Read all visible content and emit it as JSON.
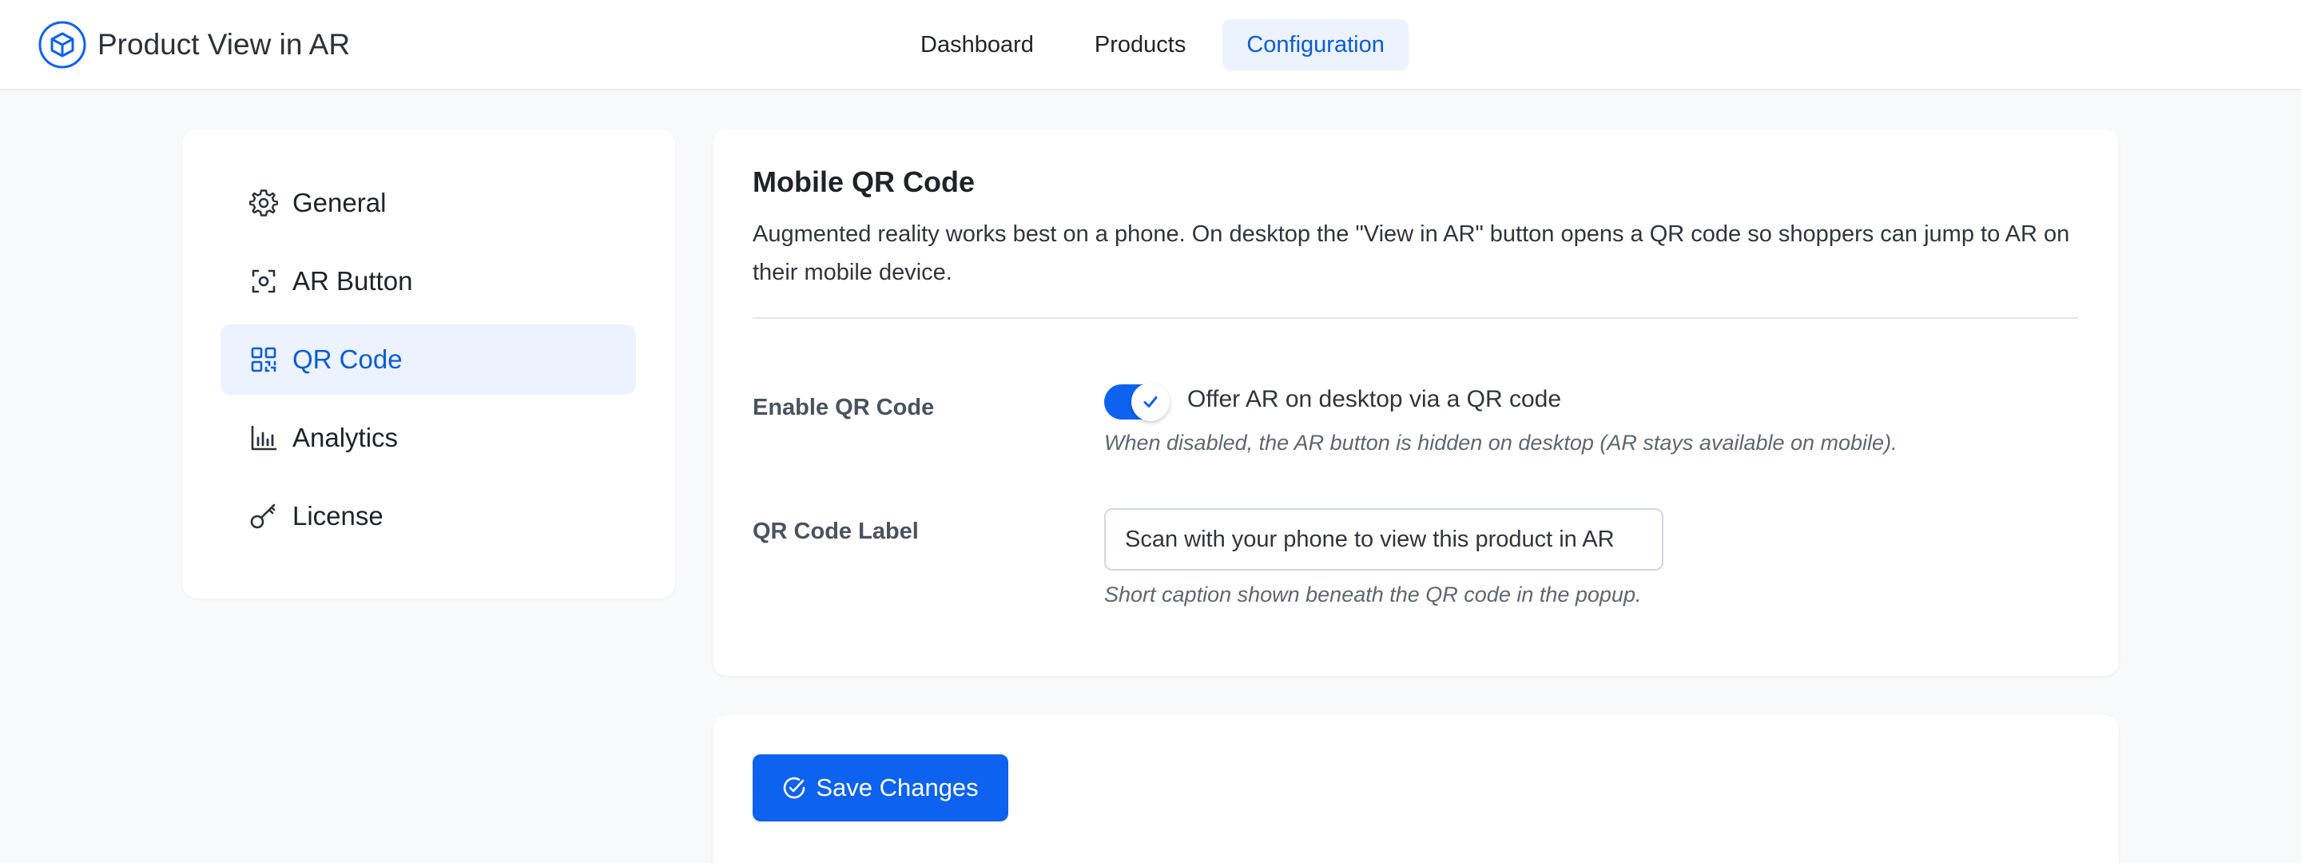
{
  "app": {
    "title": "Product View in AR",
    "logo_icon": "cube-icon",
    "accent_color": "#0d62f0"
  },
  "nav": {
    "items": [
      {
        "label": "Dashboard",
        "active": false
      },
      {
        "label": "Products",
        "active": false
      },
      {
        "label": "Configuration",
        "active": true
      }
    ]
  },
  "sidebar": {
    "items": [
      {
        "label": "General",
        "icon": "gear-icon",
        "active": false
      },
      {
        "label": "AR Button",
        "icon": "scan-icon",
        "active": false
      },
      {
        "label": "QR Code",
        "icon": "qr-code-icon",
        "active": true
      },
      {
        "label": "Analytics",
        "icon": "bar-chart-icon",
        "active": false
      },
      {
        "label": "License",
        "icon": "key-icon",
        "active": false
      }
    ]
  },
  "section": {
    "title": "Mobile QR Code",
    "description": "Augmented reality works best on a phone. On desktop the \"View in AR\" button opens a QR code so shoppers can jump to AR on their mobile device."
  },
  "fields": {
    "enable_qr": {
      "label": "Enable QR Code",
      "enabled": true,
      "toggle_text": "Offer AR on desktop via a QR code",
      "help": "When disabled, the AR button is hidden on desktop (AR stays available on mobile)."
    },
    "qr_label": {
      "label": "QR Code Label",
      "value": "Scan with your phone to view this product in AR",
      "help": "Short caption shown beneath the QR code in the popup."
    }
  },
  "actions": {
    "save_label": "Save Changes",
    "save_icon": "check-circle-icon"
  }
}
